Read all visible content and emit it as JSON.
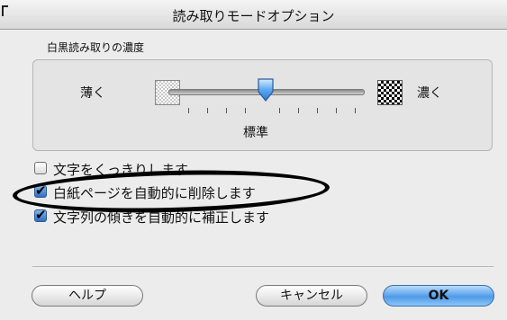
{
  "window": {
    "title": "読み取りモードオプション"
  },
  "density": {
    "group_label": "白黒読み取りの濃度",
    "light_label": "薄く",
    "dark_label": "濃く",
    "standard_label": "標準",
    "level": 0.5
  },
  "options": [
    {
      "label": "文字をくっきりします",
      "checked": false
    },
    {
      "label": "白紙ページを自動的に削除します",
      "checked": true
    },
    {
      "label": "文字列の傾きを自動的に補正します",
      "checked": true
    }
  ],
  "buttons": {
    "help": "ヘルプ",
    "cancel": "キャンセル",
    "ok": "OK"
  },
  "colors": {
    "accent": "#4f9be8",
    "window_bg": "#ececec"
  }
}
